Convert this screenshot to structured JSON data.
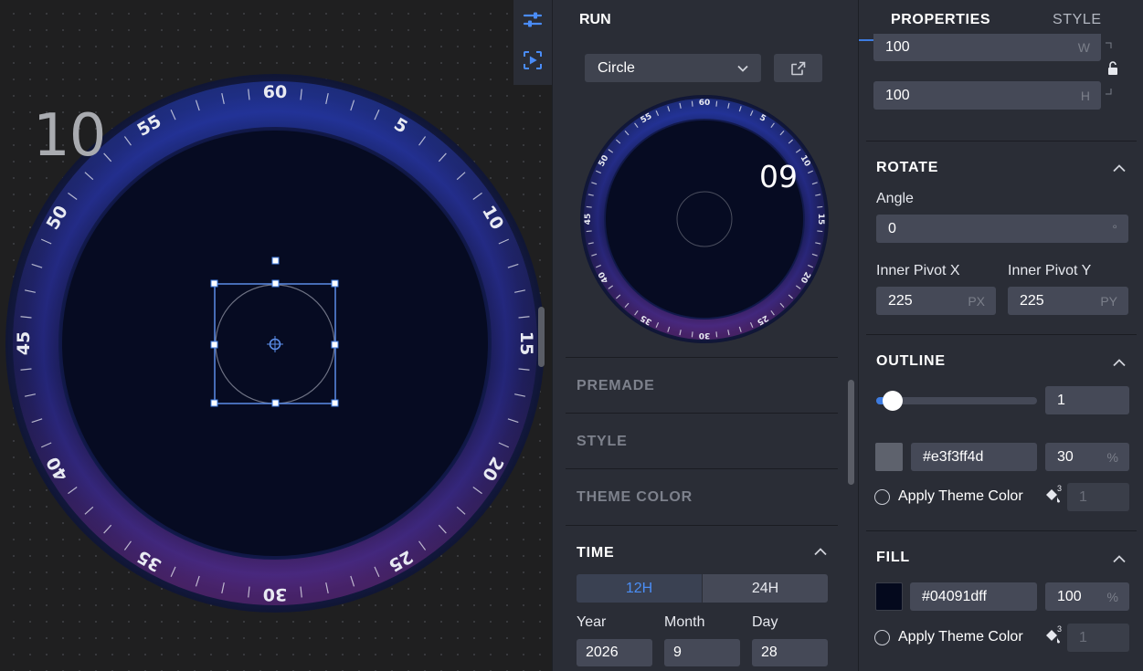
{
  "canvas": {
    "second_display": "10",
    "dial_numbers": [
      "60",
      "5",
      "10",
      "15",
      "20",
      "25",
      "30",
      "35",
      "40",
      "45",
      "50",
      "55"
    ]
  },
  "tools": [
    {
      "name": "settings-sliders-icon",
      "active": true
    },
    {
      "name": "preview-play-icon",
      "active": false
    }
  ],
  "run_panel": {
    "title": "RUN",
    "shape_select": "Circle",
    "preview_second": "09",
    "sections": [
      "PREMADE",
      "STYLE",
      "THEME COLOR"
    ],
    "time": {
      "title": "TIME",
      "format_12": "12H",
      "format_24": "24H",
      "year_label": "Year",
      "month_label": "Month",
      "day_label": "Day",
      "year": "2026",
      "month": "9",
      "day": "28"
    }
  },
  "properties_panel": {
    "tab_properties": "PROPERTIES",
    "tab_style": "STYLE",
    "size": {
      "width": "100",
      "width_unit": "W",
      "height": "100",
      "height_unit": "H"
    },
    "rotate": {
      "title": "ROTATE",
      "angle_label": "Angle",
      "angle": "0",
      "angle_unit": "°",
      "pivot_x_label": "Inner Pivot X",
      "pivot_y_label": "Inner Pivot Y",
      "pivot_x": "225",
      "pivot_x_unit": "PX",
      "pivot_y": "225",
      "pivot_y_unit": "PY"
    },
    "outline": {
      "title": "OUTLINE",
      "width": "1",
      "slider_level": 0.06,
      "color": "#e3f3ff4d",
      "opacity": "30",
      "opacity_unit": "%",
      "apply_theme_label": "Apply Theme Color",
      "theme_badge": "3",
      "theme_index": "1"
    },
    "fill": {
      "title": "FILL",
      "color": "#04091dff",
      "opacity": "100",
      "opacity_unit": "%",
      "apply_theme_label": "Apply Theme Color",
      "theme_badge": "3",
      "theme_index": "1"
    }
  },
  "colors": {
    "accent": "#3d7be0",
    "dial_face": "#060b22",
    "dial_ring_blue": "#2a3a9a",
    "dial_ring_purple": "#5a2a7a"
  }
}
